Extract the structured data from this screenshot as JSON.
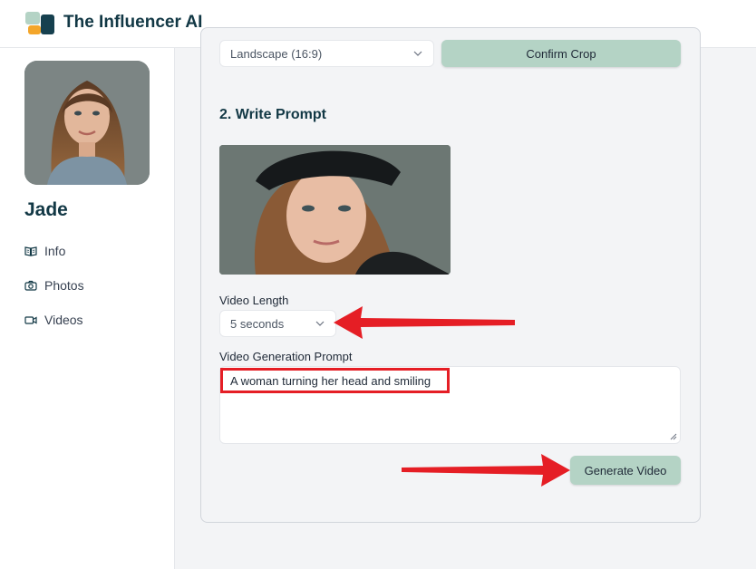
{
  "app": {
    "title": "The Influencer AI"
  },
  "profile": {
    "name": "Jade"
  },
  "sidebar": {
    "items": [
      {
        "label": "Info",
        "icon": "book-open-icon"
      },
      {
        "label": "Photos",
        "icon": "camera-icon"
      },
      {
        "label": "Videos",
        "icon": "video-camera-icon"
      }
    ]
  },
  "crop": {
    "aspect_value": "Landscape (16:9)",
    "confirm_label": "Confirm Crop"
  },
  "prompt_section": {
    "title": "2. Write Prompt",
    "video_length_label": "Video Length",
    "video_length_value": "5 seconds",
    "prompt_label": "Video Generation Prompt",
    "prompt_value": "A woman turning her head and smiling",
    "generate_label": "Generate Video"
  },
  "colors": {
    "brand": "#123845",
    "accent_green": "#b4d3c5",
    "annotation_red": "#e51e25"
  }
}
